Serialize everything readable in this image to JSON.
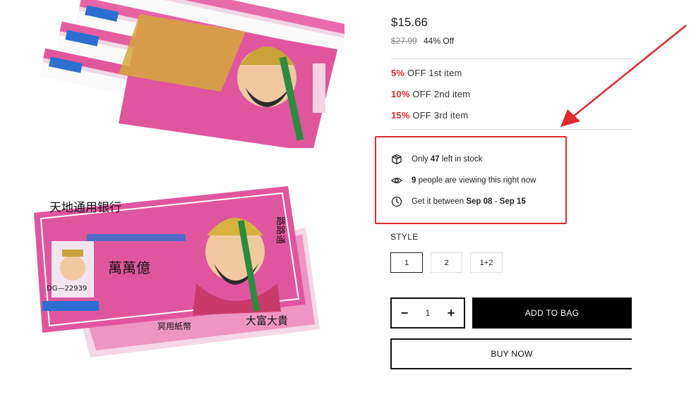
{
  "product": {
    "price": "$15.66",
    "old_price": "$27.99",
    "discount": "44% Off"
  },
  "tiers": [
    {
      "pct": "5%",
      "text": " OFF 1st item"
    },
    {
      "pct": "10%",
      "text": " OFF 2nd item"
    },
    {
      "pct": "15%",
      "text": " OFF 3rd item"
    }
  ],
  "info": {
    "stock_prefix": "Only ",
    "stock_count": "47",
    "stock_suffix": " left in stock",
    "viewers_count": "9",
    "viewers_suffix": " people are viewing this right now",
    "delivery_prefix": "Get it between ",
    "delivery_start": "Sep 08",
    "delivery_sep": " - ",
    "delivery_end": "Sep 15"
  },
  "style": {
    "label": "STYLE",
    "options": [
      "1",
      "2",
      "1+2"
    ],
    "selected": "1"
  },
  "quantity": {
    "minus": "−",
    "value": "1",
    "plus": "+"
  },
  "actions": {
    "add_to_bag": "ADD TO BAG",
    "buy_now": "BUY NOW"
  },
  "banknote": {
    "bank_name": "天地通用银行",
    "serial": "DG—22939",
    "denomination": "萬萬億",
    "side_text": "路路通",
    "bottom_text": "大富大貴",
    "footer_text": "冥用紙幣"
  },
  "icons": [
    "box-icon",
    "eye-icon",
    "clock-icon"
  ],
  "colors": {
    "accent_red": "#e0282e",
    "note_pink": "#e0569e",
    "button_black": "#000000"
  }
}
